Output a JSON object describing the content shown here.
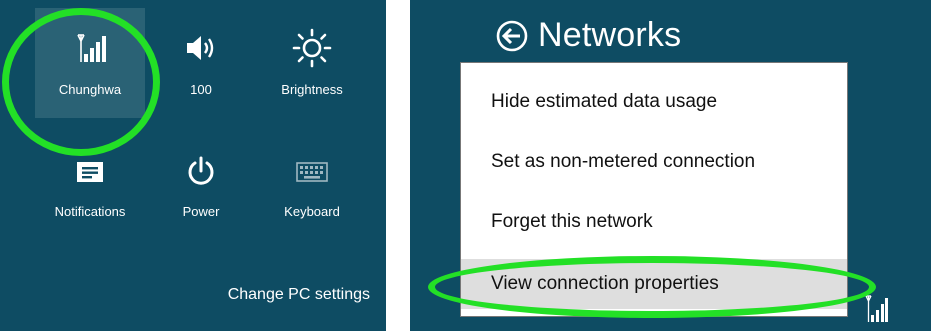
{
  "quick_settings": {
    "tiles": [
      {
        "label": "Chunghwa",
        "icon": "signal-bars-icon",
        "selected": true
      },
      {
        "label": "100",
        "icon": "speaker-icon"
      },
      {
        "label": "Brightness",
        "icon": "brightness-icon"
      },
      {
        "label": "Notifications",
        "icon": "notifications-icon"
      },
      {
        "label": "Power",
        "icon": "power-icon"
      },
      {
        "label": "Keyboard",
        "icon": "keyboard-icon"
      }
    ],
    "change_pc_settings": "Change PC settings"
  },
  "networks": {
    "title": "Networks",
    "back_icon": "back-arrow-icon",
    "menu": [
      {
        "label": "Hide estimated data usage"
      },
      {
        "label": "Set as non-metered connection"
      },
      {
        "label": "Forget this network"
      },
      {
        "label": "View connection properties",
        "hovered": true
      }
    ]
  },
  "colors": {
    "panel_bg": "#0e4c63",
    "highlight_ring": "#23e026",
    "menu_hover": "#dedede"
  }
}
